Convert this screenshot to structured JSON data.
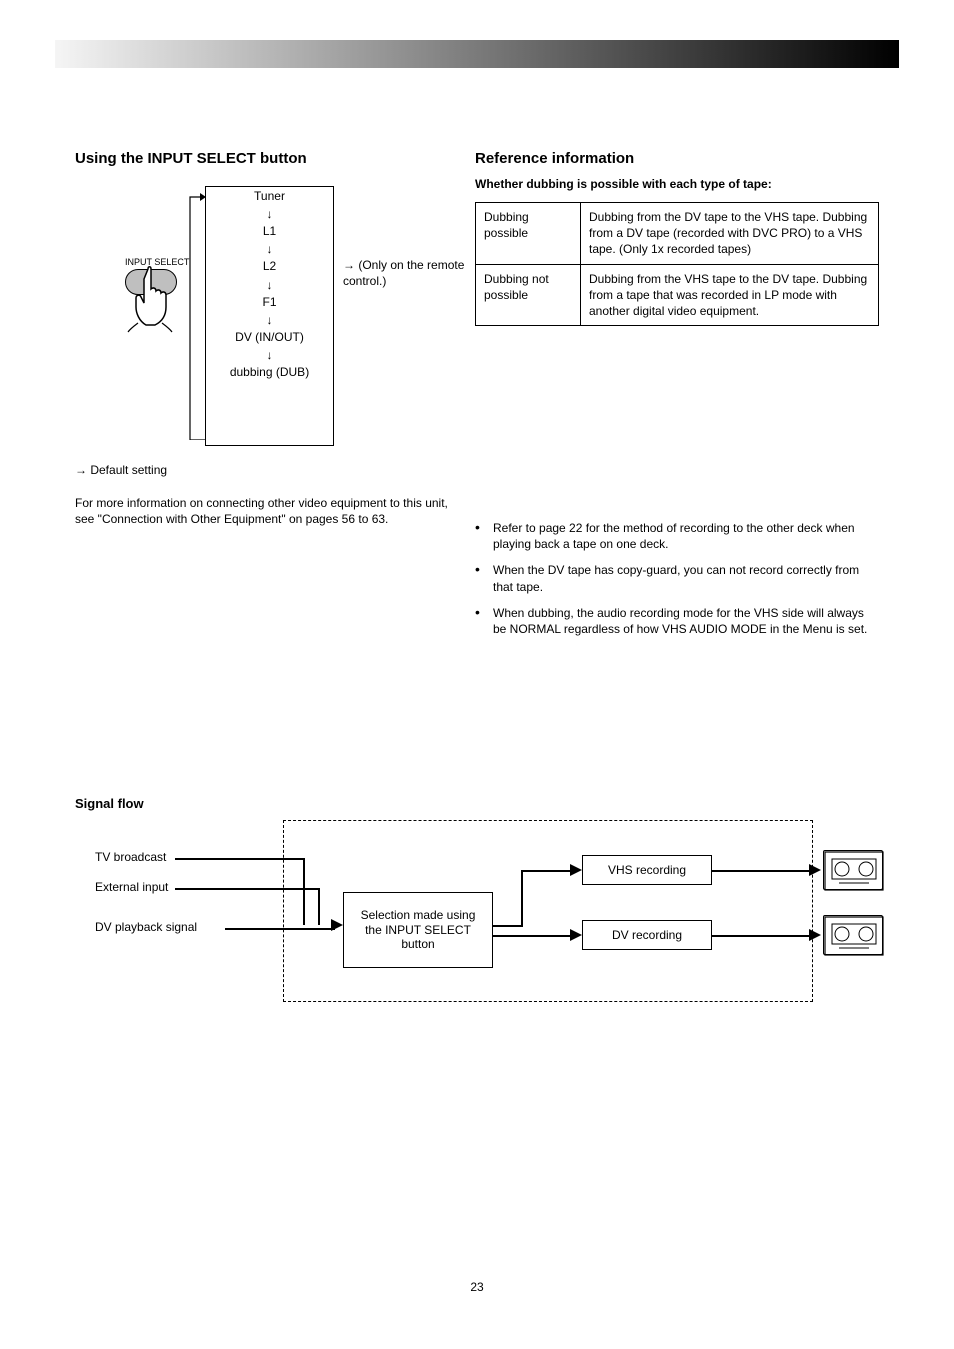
{
  "page_number": "23",
  "left": {
    "heading": "Using the INPUT SELECT button",
    "flow": {
      "items": [
        "Tuner",
        "L1",
        "L2",
        "F1",
        "DV (IN/OUT)",
        "dubbing (DUB)"
      ],
      "side_label_arrow": "→",
      "side_label_text": "(Only on the remote control.)",
      "default_arrow": "→",
      "default_text": "Default setting"
    },
    "button_label": "INPUT SELECT",
    "ref_text": "For more information on connecting other video equipment to this unit, see \"Connection with Other Equipment\" on pages 56 to 63."
  },
  "right": {
    "heading": "Reference information",
    "subheading": "Whether dubbing is possible with each type of tape:",
    "table": {
      "rows": [
        {
          "label": "Dubbing possible",
          "desc": "Dubbing from the DV tape to the VHS tape. Dubbing from a DV tape (recorded with DVC PRO) to a VHS tape. (Only 1x recorded tapes)"
        },
        {
          "label": "Dubbing not possible",
          "desc": "Dubbing from the VHS tape to the DV tape. Dubbing from a tape that was recorded in LP mode with another digital video equipment."
        }
      ]
    },
    "bullets": [
      "Refer to page 22 for the method of recording to the other deck when playing back a tape on one deck.",
      "When the DV tape has copy-guard, you can not record correctly from that tape.",
      "When dubbing, the audio recording mode for the VHS side will always be NORMAL regardless of how VHS AUDIO MODE in the Menu is set."
    ]
  },
  "diagram": {
    "title": "Signal flow",
    "labels": {
      "tv_broadcast": "TV broadcast",
      "external_input": "External input",
      "dv_playback": "DV playback signal",
      "input_select": "Selection made using\nthe INPUT SELECT\nbutton",
      "vhs_rec": "VHS recording",
      "dv_rec": "DV recording"
    }
  }
}
